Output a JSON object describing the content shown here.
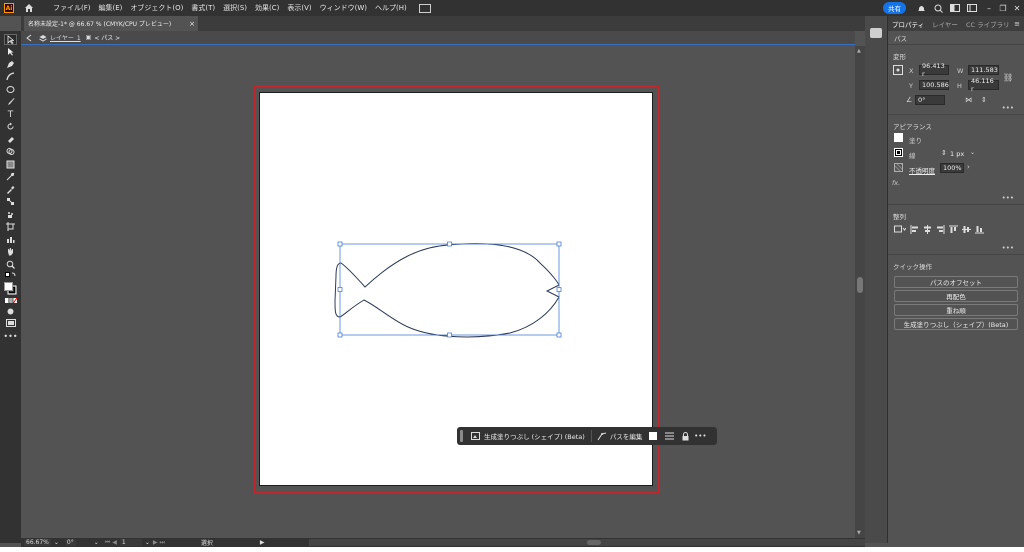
{
  "app": {
    "logo": "Ai"
  },
  "menu": [
    "ファイル(F)",
    "編集(E)",
    "オブジェクト(O)",
    "書式(T)",
    "選択(S)",
    "効果(C)",
    "表示(V)",
    "ウィンドウ(W)",
    "ヘルプ(H)"
  ],
  "topright": {
    "share_label": "共有"
  },
  "document_tab": {
    "title": "名称未設定-1* @ 66.67 % (CMYK/CPU プレビュー)",
    "close": "×"
  },
  "breadcrumb": {
    "layer": "レイヤー_1",
    "path": "< パス >"
  },
  "contextual_bar": {
    "generative_fill": "生成塗りつぶし (シェイプ) (Beta)",
    "edit_path": "パスを編集",
    "more": "•••"
  },
  "panel": {
    "tabs": [
      "プロパティ",
      "レイヤー",
      "CC ライブラリ"
    ],
    "menu_icon": "≡",
    "object_type": "パス",
    "transform": {
      "title": "変形",
      "x_label": "X",
      "x": "96.413 r",
      "y_label": "Y",
      "y": "100.586",
      "w_label": "W",
      "w": "111.583",
      "h_label": "H",
      "h": "46.116 r",
      "angle": "0°"
    },
    "appearance": {
      "title": "アピアランス",
      "fill_label": "塗り",
      "stroke_label": "線",
      "stroke_weight": "1 px",
      "opacity_label": "不透明度",
      "opacity": "100%",
      "fx": "fx."
    },
    "align": {
      "title": "整列"
    },
    "quick_actions": {
      "title": "クイック操作",
      "buttons": [
        "パスのオフセット",
        "再配色",
        "重ね順",
        "生成塗りつぶし（シェイプ）(Beta)"
      ]
    },
    "more": "•••"
  },
  "status": {
    "zoom": "66.67%",
    "angle": "0°",
    "artboard": "1",
    "tool": "選択"
  },
  "colors": {
    "selection": "#4a7fd4",
    "artboard_bleed": "#c0272d",
    "accent": "#1473e6"
  }
}
